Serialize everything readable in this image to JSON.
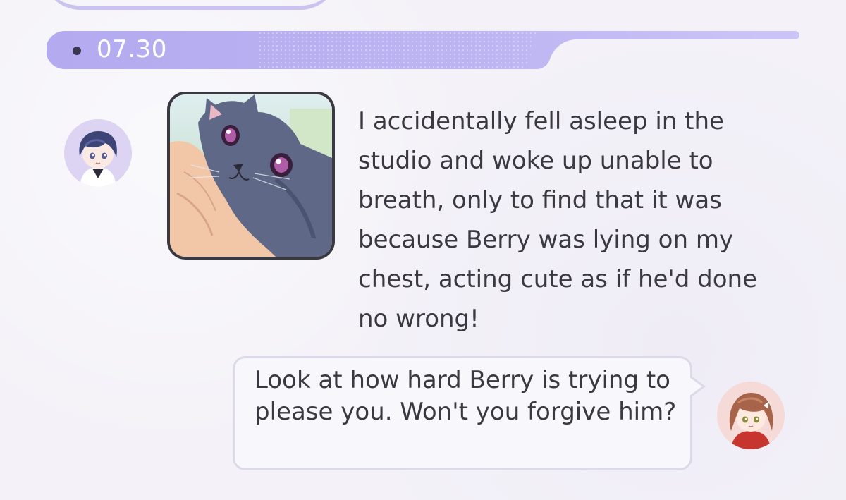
{
  "header": {
    "date": "07.30"
  },
  "conversation": {
    "npc_message": "I accidentally fell asleep in the studio and woke up unable to breath, only to find that it was because Berry was lying on my chest, acting cute as if he'd done no wrong!",
    "player_reply": "Look at how hard Berry is trying to please you. Won't you forgive him?"
  },
  "colors": {
    "banner": "#b8b0f0",
    "banner_light": "#cfc8f6",
    "background": "#f4f2f8",
    "bubble_border": "#dcd9e8",
    "text": "#3a3840"
  },
  "icons": {
    "npc_avatar": "character-avatar-dark-hair",
    "player_avatar": "character-avatar-brown-hair",
    "photo": "gray-cat-photo"
  }
}
